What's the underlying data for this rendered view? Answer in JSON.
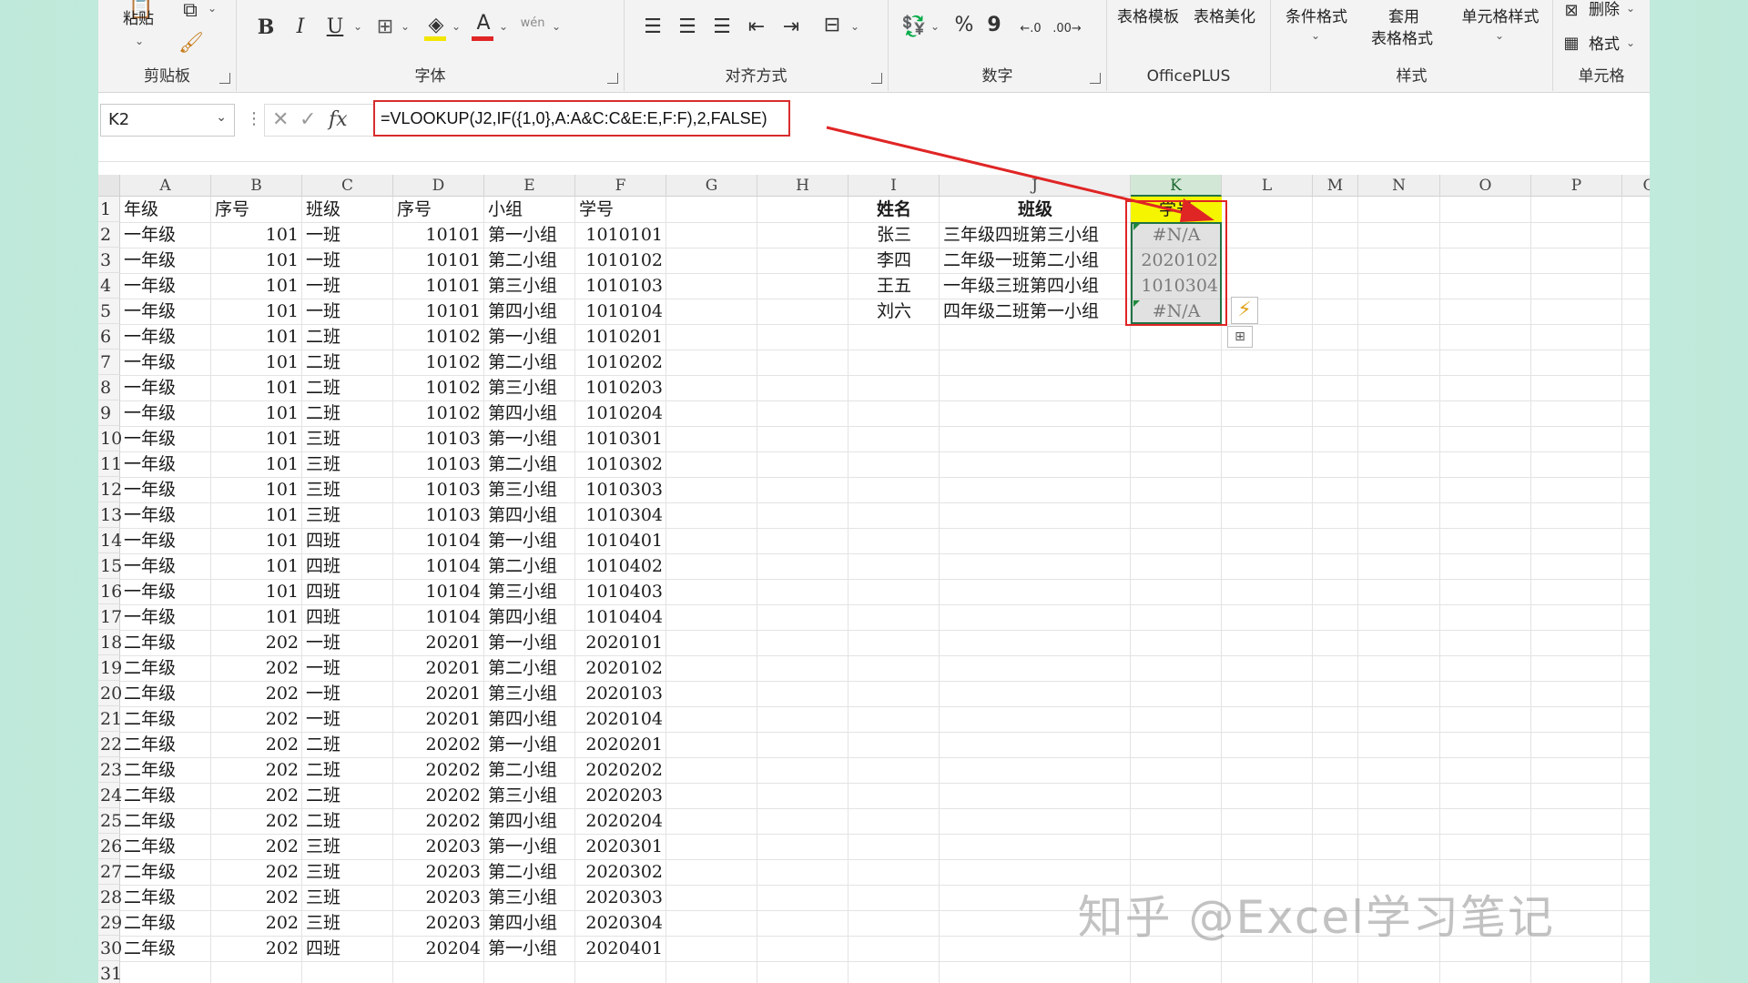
{
  "ribbon": {
    "groups": {
      "clipboard": "剪贴板",
      "font": "字体",
      "align": "对齐方式",
      "number": "数字",
      "officeplus": "OfficePLUS",
      "style": "样式",
      "cells": "单元格"
    },
    "paste_label": "粘贴",
    "table_template": "表格模板",
    "table_beautify": "表格美化",
    "cond_format": "条件格式",
    "apply_table_1": "套用",
    "apply_table_2": "表格格式",
    "cell_style": "单元格样式",
    "delete_label": "删除",
    "format_label": "格式",
    "bold": "B",
    "italic": "I",
    "underline": "U",
    "font_color": "A",
    "pinyin": "wén",
    "percent": "%",
    "comma": "9",
    "inc_decimal": "←.0",
    "dec_decimal": ".00→",
    "fill_color": "#f2e600",
    "font_color_bar": "#e02525"
  },
  "formula_bar": {
    "name_box": "K2",
    "formula": "=VLOOKUP(J2,IF({1,0},A:A&C:C&E:E,F:F),2,FALSE)",
    "fx": "fx"
  },
  "columns": [
    "A",
    "B",
    "C",
    "D",
    "E",
    "F",
    "G",
    "H",
    "I",
    "J",
    "K",
    "L",
    "M",
    "N",
    "O",
    "P",
    "Q"
  ],
  "selected_column": "K",
  "headers": {
    "A": "年级",
    "B": "序号",
    "C": "班级",
    "D": "序号",
    "E": "小组",
    "F": "学号"
  },
  "rows": [
    [
      "一年级",
      "101",
      "一班",
      "10101",
      "第一小组",
      "1010101"
    ],
    [
      "一年级",
      "101",
      "一班",
      "10101",
      "第二小组",
      "1010102"
    ],
    [
      "一年级",
      "101",
      "一班",
      "10101",
      "第三小组",
      "1010103"
    ],
    [
      "一年级",
      "101",
      "一班",
      "10101",
      "第四小组",
      "1010104"
    ],
    [
      "一年级",
      "101",
      "二班",
      "10102",
      "第一小组",
      "1010201"
    ],
    [
      "一年级",
      "101",
      "二班",
      "10102",
      "第二小组",
      "1010202"
    ],
    [
      "一年级",
      "101",
      "二班",
      "10102",
      "第三小组",
      "1010203"
    ],
    [
      "一年级",
      "101",
      "二班",
      "10102",
      "第四小组",
      "1010204"
    ],
    [
      "一年级",
      "101",
      "三班",
      "10103",
      "第一小组",
      "1010301"
    ],
    [
      "一年级",
      "101",
      "三班",
      "10103",
      "第二小组",
      "1010302"
    ],
    [
      "一年级",
      "101",
      "三班",
      "10103",
      "第三小组",
      "1010303"
    ],
    [
      "一年级",
      "101",
      "三班",
      "10103",
      "第四小组",
      "1010304"
    ],
    [
      "一年级",
      "101",
      "四班",
      "10104",
      "第一小组",
      "1010401"
    ],
    [
      "一年级",
      "101",
      "四班",
      "10104",
      "第二小组",
      "1010402"
    ],
    [
      "一年级",
      "101",
      "四班",
      "10104",
      "第三小组",
      "1010403"
    ],
    [
      "一年级",
      "101",
      "四班",
      "10104",
      "第四小组",
      "1010404"
    ],
    [
      "二年级",
      "202",
      "一班",
      "20201",
      "第一小组",
      "2020101"
    ],
    [
      "二年级",
      "202",
      "一班",
      "20201",
      "第二小组",
      "2020102"
    ],
    [
      "二年级",
      "202",
      "一班",
      "20201",
      "第三小组",
      "2020103"
    ],
    [
      "二年级",
      "202",
      "一班",
      "20201",
      "第四小组",
      "2020104"
    ],
    [
      "二年级",
      "202",
      "二班",
      "20202",
      "第一小组",
      "2020201"
    ],
    [
      "二年级",
      "202",
      "二班",
      "20202",
      "第二小组",
      "2020202"
    ],
    [
      "二年级",
      "202",
      "二班",
      "20202",
      "第三小组",
      "2020203"
    ],
    [
      "二年级",
      "202",
      "二班",
      "20202",
      "第四小组",
      "2020204"
    ],
    [
      "二年级",
      "202",
      "三班",
      "20203",
      "第一小组",
      "2020301"
    ],
    [
      "二年级",
      "202",
      "三班",
      "20203",
      "第二小组",
      "2020302"
    ],
    [
      "二年级",
      "202",
      "三班",
      "20203",
      "第三小组",
      "2020303"
    ],
    [
      "二年级",
      "202",
      "三班",
      "20203",
      "第四小组",
      "2020304"
    ],
    [
      "二年级",
      "202",
      "四班",
      "20204",
      "第一小组",
      "2020401"
    ]
  ],
  "row_numbers": [
    "1",
    "2",
    "3",
    "4",
    "5",
    "6",
    "7",
    "8",
    "9",
    "10",
    "11",
    "12",
    "13",
    "14",
    "15",
    "16",
    "17",
    "18",
    "19",
    "20",
    "21",
    "22",
    "23",
    "24",
    "25",
    "26",
    "27",
    "28",
    "29",
    "30",
    "31"
  ],
  "lookup": {
    "header_name": "姓名",
    "header_class": "班级",
    "header_id": "学号",
    "items": [
      {
        "name": "张三",
        "class": "三年级四班第三小组",
        "id": "#N/A"
      },
      {
        "name": "李四",
        "class": "二年级一班第二小组",
        "id": "2020102"
      },
      {
        "name": "王五",
        "class": "一年级三班第四小组",
        "id": "1010304"
      },
      {
        "name": "刘六",
        "class": "四年级二班第一小组",
        "id": "#N/A"
      }
    ]
  },
  "watermark": "知乎 @Excel学习笔记",
  "colors": {
    "selection_green": "#217346",
    "highlight_red": "#e02525",
    "header_yellow": "#f5f500"
  }
}
